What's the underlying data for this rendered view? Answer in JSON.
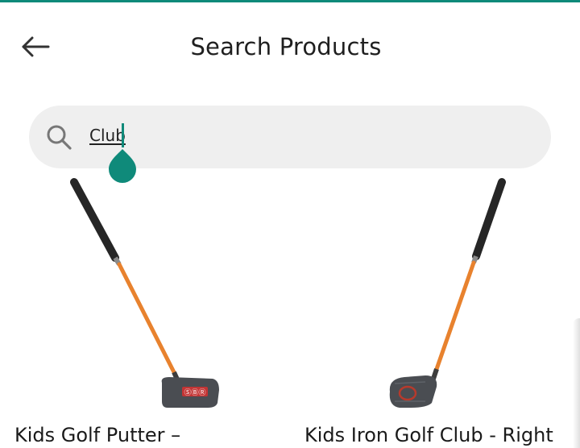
{
  "header": {
    "title": "Search Products",
    "back_icon": "arrow-left-icon"
  },
  "search": {
    "icon": "search-icon",
    "value": "Club"
  },
  "products": [
    {
      "title": "Kids Golf Putter –"
    },
    {
      "title": "Kids Iron Golf Club - Right"
    }
  ],
  "colors": {
    "accent": "#0f8a7a",
    "search_bg": "#efefef",
    "shaft": "#e8822e",
    "grip": "#2a2a2a",
    "club_head": "#4a4d52"
  }
}
